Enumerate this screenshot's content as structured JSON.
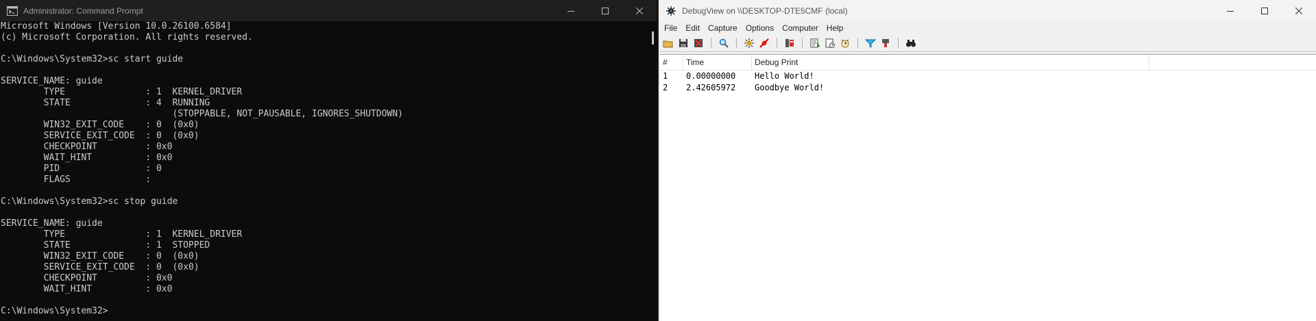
{
  "cmd": {
    "title": "Administrator: Command Prompt",
    "icons": {
      "app": "cmd-icon",
      "minimize": "minimize-icon",
      "maximize": "maximize-icon",
      "close": "close-icon"
    },
    "lines": [
      "Microsoft Windows [Version 10.0.26100.6584]",
      "(c) Microsoft Corporation. All rights reserved.",
      "",
      "C:\\Windows\\System32>sc start guide",
      "",
      "SERVICE_NAME: guide",
      "        TYPE               : 1  KERNEL_DRIVER",
      "        STATE              : 4  RUNNING",
      "                                (STOPPABLE, NOT_PAUSABLE, IGNORES_SHUTDOWN)",
      "        WIN32_EXIT_CODE    : 0  (0x0)",
      "        SERVICE_EXIT_CODE  : 0  (0x0)",
      "        CHECKPOINT         : 0x0",
      "        WAIT_HINT          : 0x0",
      "        PID                : 0",
      "        FLAGS              :",
      "",
      "C:\\Windows\\System32>sc stop guide",
      "",
      "SERVICE_NAME: guide",
      "        TYPE               : 1  KERNEL_DRIVER",
      "        STATE              : 1  STOPPED",
      "        WIN32_EXIT_CODE    : 0  (0x0)",
      "        SERVICE_EXIT_CODE  : 0  (0x0)",
      "        CHECKPOINT         : 0x0",
      "        WAIT_HINT          : 0x0",
      "",
      "C:\\Windows\\System32>"
    ]
  },
  "debugview": {
    "title": "DebugView on \\\\DESKTOP-DTE5CMF (local)",
    "menu": [
      "File",
      "Edit",
      "Capture",
      "Options",
      "Computer",
      "Help"
    ],
    "toolbar_icons": [
      "open-icon",
      "save-icon",
      "clear-display-icon",
      "sep",
      "find-icon",
      "sep",
      "capture-icon",
      "stop-capture-icon",
      "sep",
      "capture-kernel-icon",
      "sep",
      "autoscroll-icon",
      "clock-time-icon",
      "history-icon",
      "sep",
      "filter-icon",
      "highlight-icon",
      "sep",
      "binoculars-icon"
    ],
    "columns": [
      "#",
      "Time",
      "Debug Print"
    ],
    "rows": [
      [
        "1",
        "0.00000000",
        "Hello World!"
      ],
      [
        "2",
        "2.42605972",
        "Goodbye World!"
      ]
    ]
  }
}
